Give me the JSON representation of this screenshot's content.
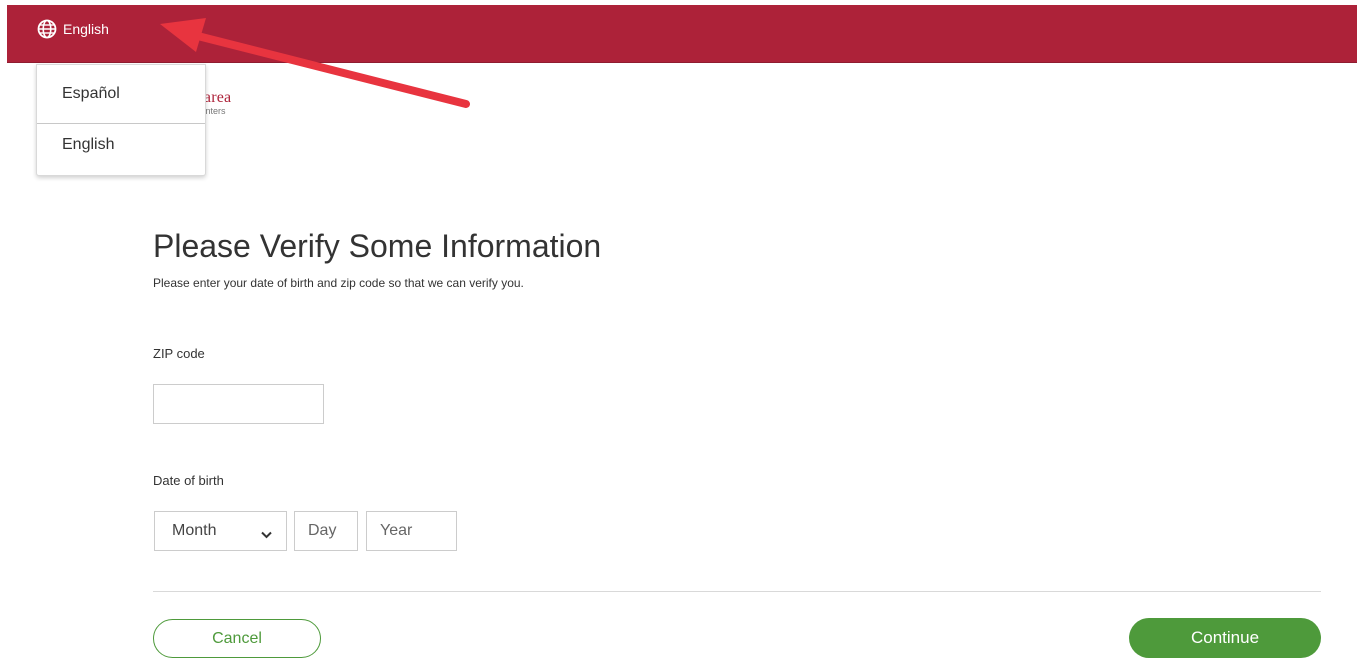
{
  "header": {
    "language_label": "English",
    "globe_icon": "globe-icon",
    "bar_color": "#ad2239"
  },
  "language_menu": {
    "items": [
      {
        "label": "Español"
      },
      {
        "label": "English"
      }
    ]
  },
  "logo": {
    "line1": "as area",
    "line2": "th centers"
  },
  "page": {
    "title": "Please Verify Some Information",
    "subtitle": "Please enter your date of birth and zip code so that we can verify you."
  },
  "form": {
    "zip_label": "ZIP code",
    "zip_value": "",
    "dob_label": "Date of birth",
    "month_value": "Month",
    "month_icon": "chevron-down-icon",
    "day_placeholder": "Day",
    "year_placeholder": "Year"
  },
  "actions": {
    "cancel_label": "Cancel",
    "continue_label": "Continue",
    "accent_color": "#4e9a3b"
  },
  "annotation": {
    "arrow_color": "#e8343f"
  }
}
